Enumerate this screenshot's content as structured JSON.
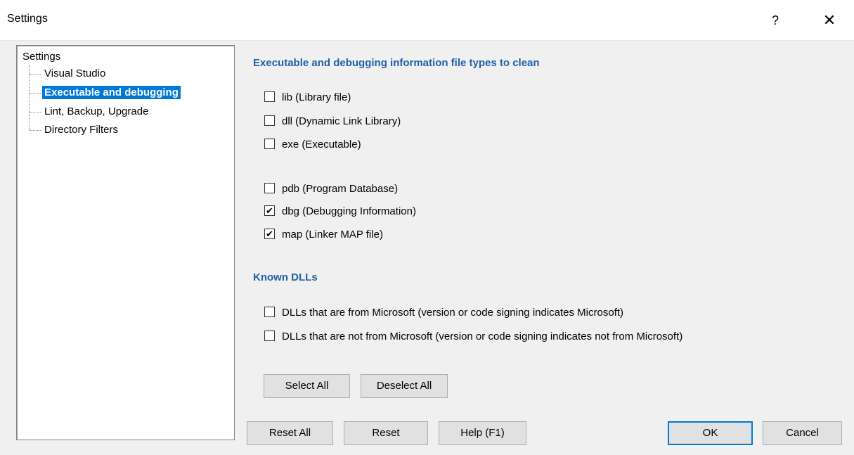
{
  "window": {
    "title": "Settings",
    "help_glyph": "?",
    "close_glyph": "✕"
  },
  "tree": {
    "root": "Settings",
    "items": [
      {
        "label": "Visual Studio",
        "selected": false
      },
      {
        "label": "Executable and debugging",
        "selected": true
      },
      {
        "label": "Lint, Backup, Upgrade",
        "selected": false
      },
      {
        "label": "Directory Filters",
        "selected": false
      }
    ]
  },
  "section1": {
    "title": "Executable and debugging information file types to clean",
    "options": [
      {
        "label": "lib (Library file)",
        "checked": false
      },
      {
        "label": "dll (Dynamic Link Library)",
        "checked": false
      },
      {
        "label": "exe (Executable)",
        "checked": false
      },
      {
        "label": "pdb (Program Database)",
        "checked": false
      },
      {
        "label": "dbg (Debugging Information)",
        "checked": true
      },
      {
        "label": "map (Linker MAP file)",
        "checked": true
      }
    ]
  },
  "section2": {
    "title": "Known DLLs",
    "options": [
      {
        "label": "DLLs that are from Microsoft (version or code signing indicates Microsoft)",
        "checked": false
      },
      {
        "label": "DLLs that are not from Microsoft (version or code signing indicates not from Microsoft)",
        "checked": false
      }
    ]
  },
  "buttons": {
    "select_all": "Select All",
    "deselect_all": "Deselect All",
    "reset_all": "Reset All",
    "reset": "Reset",
    "help": "Help (F1)",
    "ok": "OK",
    "cancel": "Cancel"
  },
  "colors": {
    "accent": "#0078d7",
    "section_title": "#1f5fa6"
  },
  "check_glyph": "✔"
}
